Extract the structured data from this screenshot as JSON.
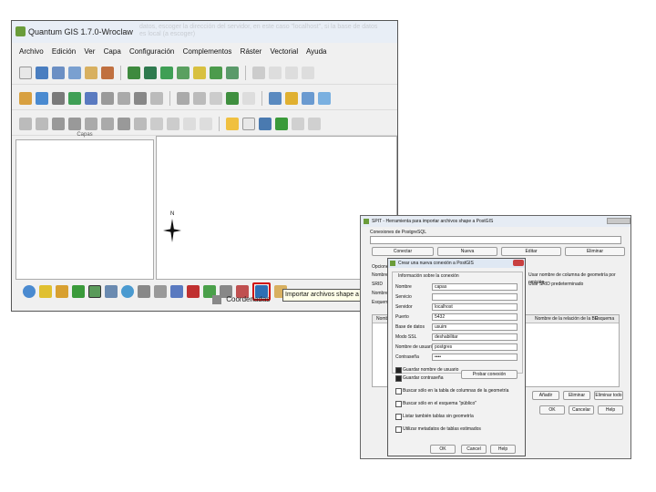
{
  "qgis": {
    "title": "Quantum GIS 1.7.0-Wroclaw",
    "ghost_text": "datos, escoger la dirección del servidor, en este caso \"localhost\", si la base de datos es local (a escoger)",
    "menus": [
      "Archivo",
      "Edición",
      "Ver",
      "Capa",
      "Configuración",
      "Complementos",
      "Ráster",
      "Vectorial",
      "Ayuda"
    ],
    "layers_panel_title": "Capas",
    "north_label": "N",
    "coord_label": "Coordenadas",
    "tooltip": "Importar archivos shape a PostGIS"
  },
  "spit": {
    "title": "SPIT - Herramienta para importar archivos shape a PostGIS",
    "connections_label": "Conexiones de PostgreSQL",
    "buttons": {
      "connect": "Conectar",
      "new": "Nueva",
      "edit": "Editar",
      "delete": "Eliminar"
    },
    "options_label": "Opciones",
    "geom_label": "Usar nombre de columna de geometría por omisión",
    "srid_label": "Usar SRID predeterminado",
    "row_labels": {
      "name": "Nombre",
      "srid": "SRID",
      "name2": "Nombre",
      "schema": "Esquema"
    },
    "table_headers": {
      "name": "Nombre",
      "relation": "Nombre de la relación de la BD",
      "schema": "Esquema"
    },
    "bottom_buttons": {
      "add": "Añadir",
      "remove": "Eliminar",
      "remove_all": "Eliminar todo"
    },
    "dialog_buttons": {
      "ok": "OK",
      "cancel": "Cancelar",
      "help": "Help"
    }
  },
  "dialog": {
    "title": "Crear una nueva conexión a PostGIS",
    "group_title": "Información sobre la conexión",
    "fields": [
      {
        "label": "Nombre",
        "value": "capas"
      },
      {
        "label": "Servicio",
        "value": ""
      },
      {
        "label": "Servidor",
        "value": "localhost"
      },
      {
        "label": "Puerto",
        "value": "5432"
      },
      {
        "label": "Base de datos",
        "value": "usuim"
      },
      {
        "label": "Modo SSL",
        "value": "deshabilitar"
      },
      {
        "label": "Nombre de usuario",
        "value": "postgres"
      },
      {
        "label": "Contraseña",
        "value": "••••"
      }
    ],
    "save_user": "Guardar nombre de usuario",
    "save_password": "Guardar contraseña",
    "test_button": "Probar conexión",
    "opt1": "Buscar sólo en la tabla de columnas de la geometría",
    "opt2": "Buscar sólo en el esquema \"público\"",
    "opt3": "Listar también tablas sin geometría",
    "opt4": "Utilizar metadatos de tablas estimados",
    "ok": "OK",
    "cancel": "Cancel",
    "help": "Help"
  },
  "colors": {
    "highlight": "#d01010",
    "accent": "#2e6fb5"
  }
}
